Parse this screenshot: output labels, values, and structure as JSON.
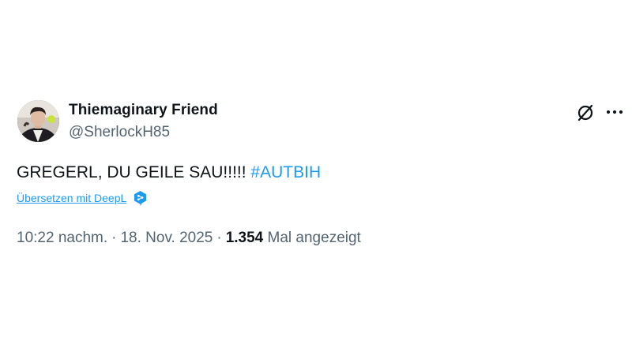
{
  "tweet": {
    "author": {
      "display_name": "Thiemaginary Friend",
      "handle": "@SherlockH85"
    },
    "text": "GREGERL, DU GEILE SAU!!!!! ",
    "hashtag": "#AUTBIH",
    "translate_label": "Übersetzen mit DeepL",
    "time": "10:22 nachm.",
    "separator": "·",
    "date": "18. Nov. 2025",
    "views_count": "1.354",
    "views_label": "Mal angezeigt"
  },
  "icons": {
    "grok": "grok-icon",
    "more": "more-icon",
    "deepl": "deepl-icon"
  },
  "colors": {
    "link": "#1d9bf0",
    "text": "#0f1419",
    "secondary": "#536471"
  }
}
